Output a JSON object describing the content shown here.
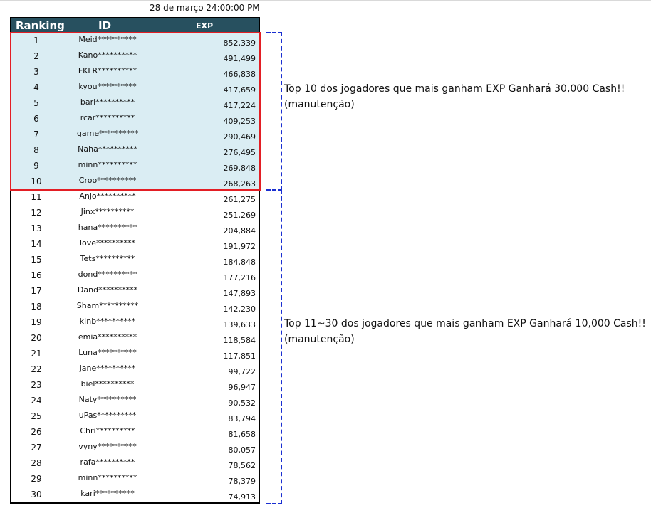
{
  "date": "28 de março 24:00:00 PM",
  "header": {
    "ranking": "Ranking",
    "id": "ID",
    "exp": "EXP"
  },
  "rows": [
    {
      "rank": "1",
      "id": "Meid**********",
      "exp": "852,339"
    },
    {
      "rank": "2",
      "id": "Kano**********",
      "exp": "491,499"
    },
    {
      "rank": "3",
      "id": "FKLR**********",
      "exp": "466,838"
    },
    {
      "rank": "4",
      "id": "kyou**********",
      "exp": "417,659"
    },
    {
      "rank": "5",
      "id": "bari**********",
      "exp": "417,224"
    },
    {
      "rank": "6",
      "id": "rcar**********",
      "exp": "409,253"
    },
    {
      "rank": "7",
      "id": "game**********",
      "exp": "290,469"
    },
    {
      "rank": "8",
      "id": "Naha**********",
      "exp": "276,495"
    },
    {
      "rank": "9",
      "id": "minn**********",
      "exp": "269,848"
    },
    {
      "rank": "10",
      "id": "Croo**********",
      "exp": "268,263"
    },
    {
      "rank": "11",
      "id": "Anjo**********",
      "exp": "261,275"
    },
    {
      "rank": "12",
      "id": "Jinx**********",
      "exp": "251,269"
    },
    {
      "rank": "13",
      "id": "hana**********",
      "exp": "204,884"
    },
    {
      "rank": "14",
      "id": "love**********",
      "exp": "191,972"
    },
    {
      "rank": "15",
      "id": "Tets**********",
      "exp": "184,848"
    },
    {
      "rank": "16",
      "id": "dond**********",
      "exp": "177,216"
    },
    {
      "rank": "17",
      "id": "Dand**********",
      "exp": "147,893"
    },
    {
      "rank": "18",
      "id": "Sham**********",
      "exp": "142,230"
    },
    {
      "rank": "19",
      "id": "kinb**********",
      "exp": "139,633"
    },
    {
      "rank": "20",
      "id": "emia**********",
      "exp": "118,584"
    },
    {
      "rank": "21",
      "id": "Luna**********",
      "exp": "117,851"
    },
    {
      "rank": "22",
      "id": "jane**********",
      "exp": "99,722"
    },
    {
      "rank": "23",
      "id": "biel**********",
      "exp": "96,947"
    },
    {
      "rank": "24",
      "id": "Naty**********",
      "exp": "90,532"
    },
    {
      "rank": "25",
      "id": "uPas**********",
      "exp": "83,794"
    },
    {
      "rank": "26",
      "id": "Chri**********",
      "exp": "81,658"
    },
    {
      "rank": "27",
      "id": "vyny**********",
      "exp": "80,057"
    },
    {
      "rank": "28",
      "id": "rafa**********",
      "exp": "78,562"
    },
    {
      "rank": "29",
      "id": "minn**********",
      "exp": "78,379"
    },
    {
      "rank": "30",
      "id": "kari**********",
      "exp": "74,913"
    }
  ],
  "notes": {
    "top10_line1": "Top 10 dos jogadores que mais ganham EXP Ganhará 30,000 Cash!!",
    "top10_line2": "(manutenção)",
    "top11_30_line1": "Top 11~30 dos jogadores que mais ganham EXP Ganhará 10,000 Cash!!",
    "top11_30_line2": "(manutenção)"
  },
  "colors": {
    "header_bg": "#27505f",
    "top10_bg": "#daedf3",
    "top10_border": "#e31e24",
    "bracket": "#1a2fd1"
  }
}
